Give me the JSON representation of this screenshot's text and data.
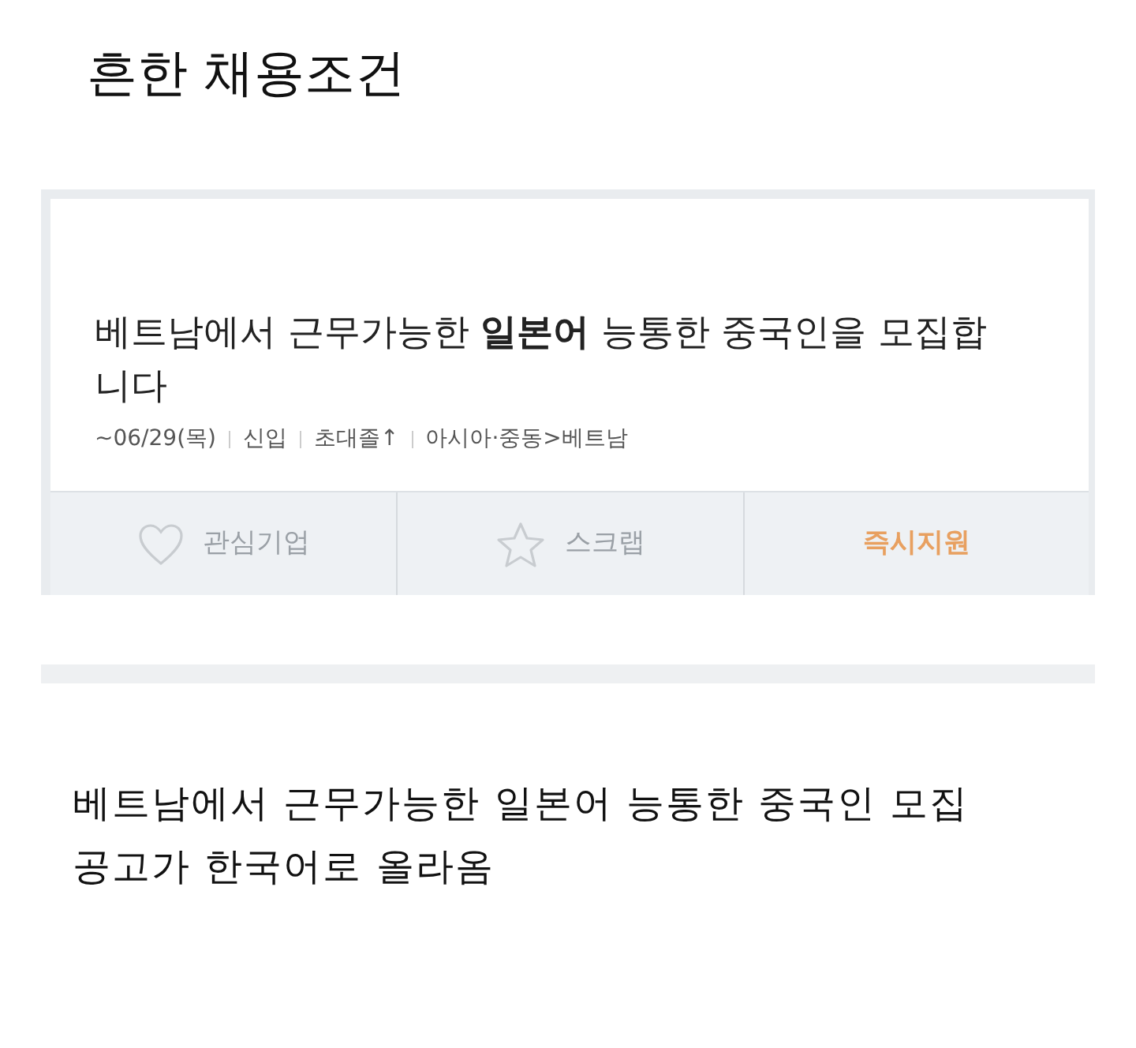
{
  "heading": "흔한 채용조건",
  "posting": {
    "title": "베트남에서 근무가능한 **일본어** 능통한 중국인을 모집합니다",
    "meta": [
      "~06/29(목)",
      "신입",
      "초대졸↑",
      "아시아·중동>베트남"
    ],
    "actions": [
      {
        "kind": "heart",
        "label": "관심기업"
      },
      {
        "kind": "star",
        "label": "스크랩"
      },
      {
        "kind": "apply",
        "label": "즉시지원"
      }
    ]
  },
  "caption": "베트남에서 근무가능한 일본어 능통한 중국인 모집 공고가 한국어로 올라옴"
}
